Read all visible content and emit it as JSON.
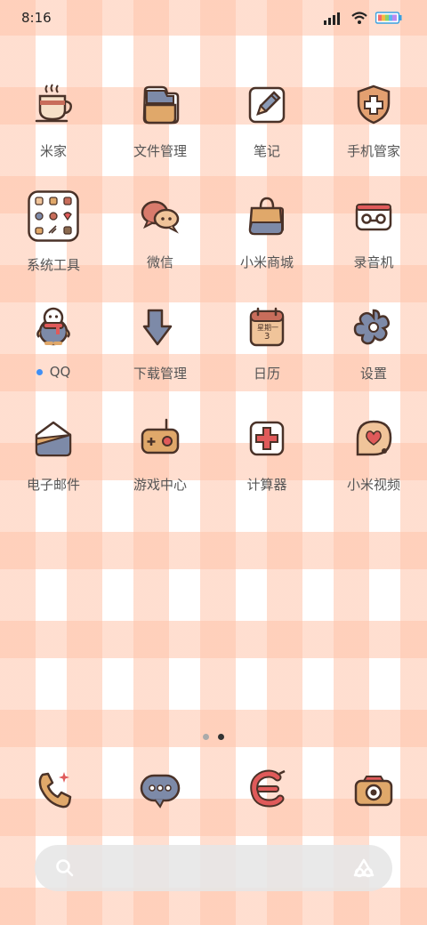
{
  "status": {
    "time": "8:16"
  },
  "apps": [
    {
      "label": "米家",
      "icon": "teacup-icon"
    },
    {
      "label": "文件管理",
      "icon": "folder-icon"
    },
    {
      "label": "笔记",
      "icon": "notes-pencil-icon"
    },
    {
      "label": "手机管家",
      "icon": "shield-cross-icon"
    },
    {
      "label": "系统工具",
      "icon": "system-tools-folder-icon"
    },
    {
      "label": "微信",
      "icon": "chat-bubbles-icon"
    },
    {
      "label": "小米商城",
      "icon": "shopping-bag-icon"
    },
    {
      "label": "录音机",
      "icon": "recorder-icon"
    },
    {
      "label": "QQ",
      "icon": "penguin-icon"
    },
    {
      "label": "下载管理",
      "icon": "download-arrow-icon"
    },
    {
      "label": "日历",
      "icon": "calendar-icon",
      "text1": "星期一",
      "text2": "3"
    },
    {
      "label": "设置",
      "icon": "gear-flower-icon"
    },
    {
      "label": "电子邮件",
      "icon": "envelope-icon"
    },
    {
      "label": "游戏中心",
      "icon": "game-console-icon"
    },
    {
      "label": "计算器",
      "icon": "calculator-plus-icon"
    },
    {
      "label": "小米视频",
      "icon": "video-heart-icon"
    }
  ],
  "dock": [
    {
      "icon": "phone-icon"
    },
    {
      "icon": "messages-icon"
    },
    {
      "icon": "browser-icon"
    },
    {
      "icon": "camera-icon"
    }
  ],
  "pager": {
    "count": 2,
    "active": 2
  }
}
